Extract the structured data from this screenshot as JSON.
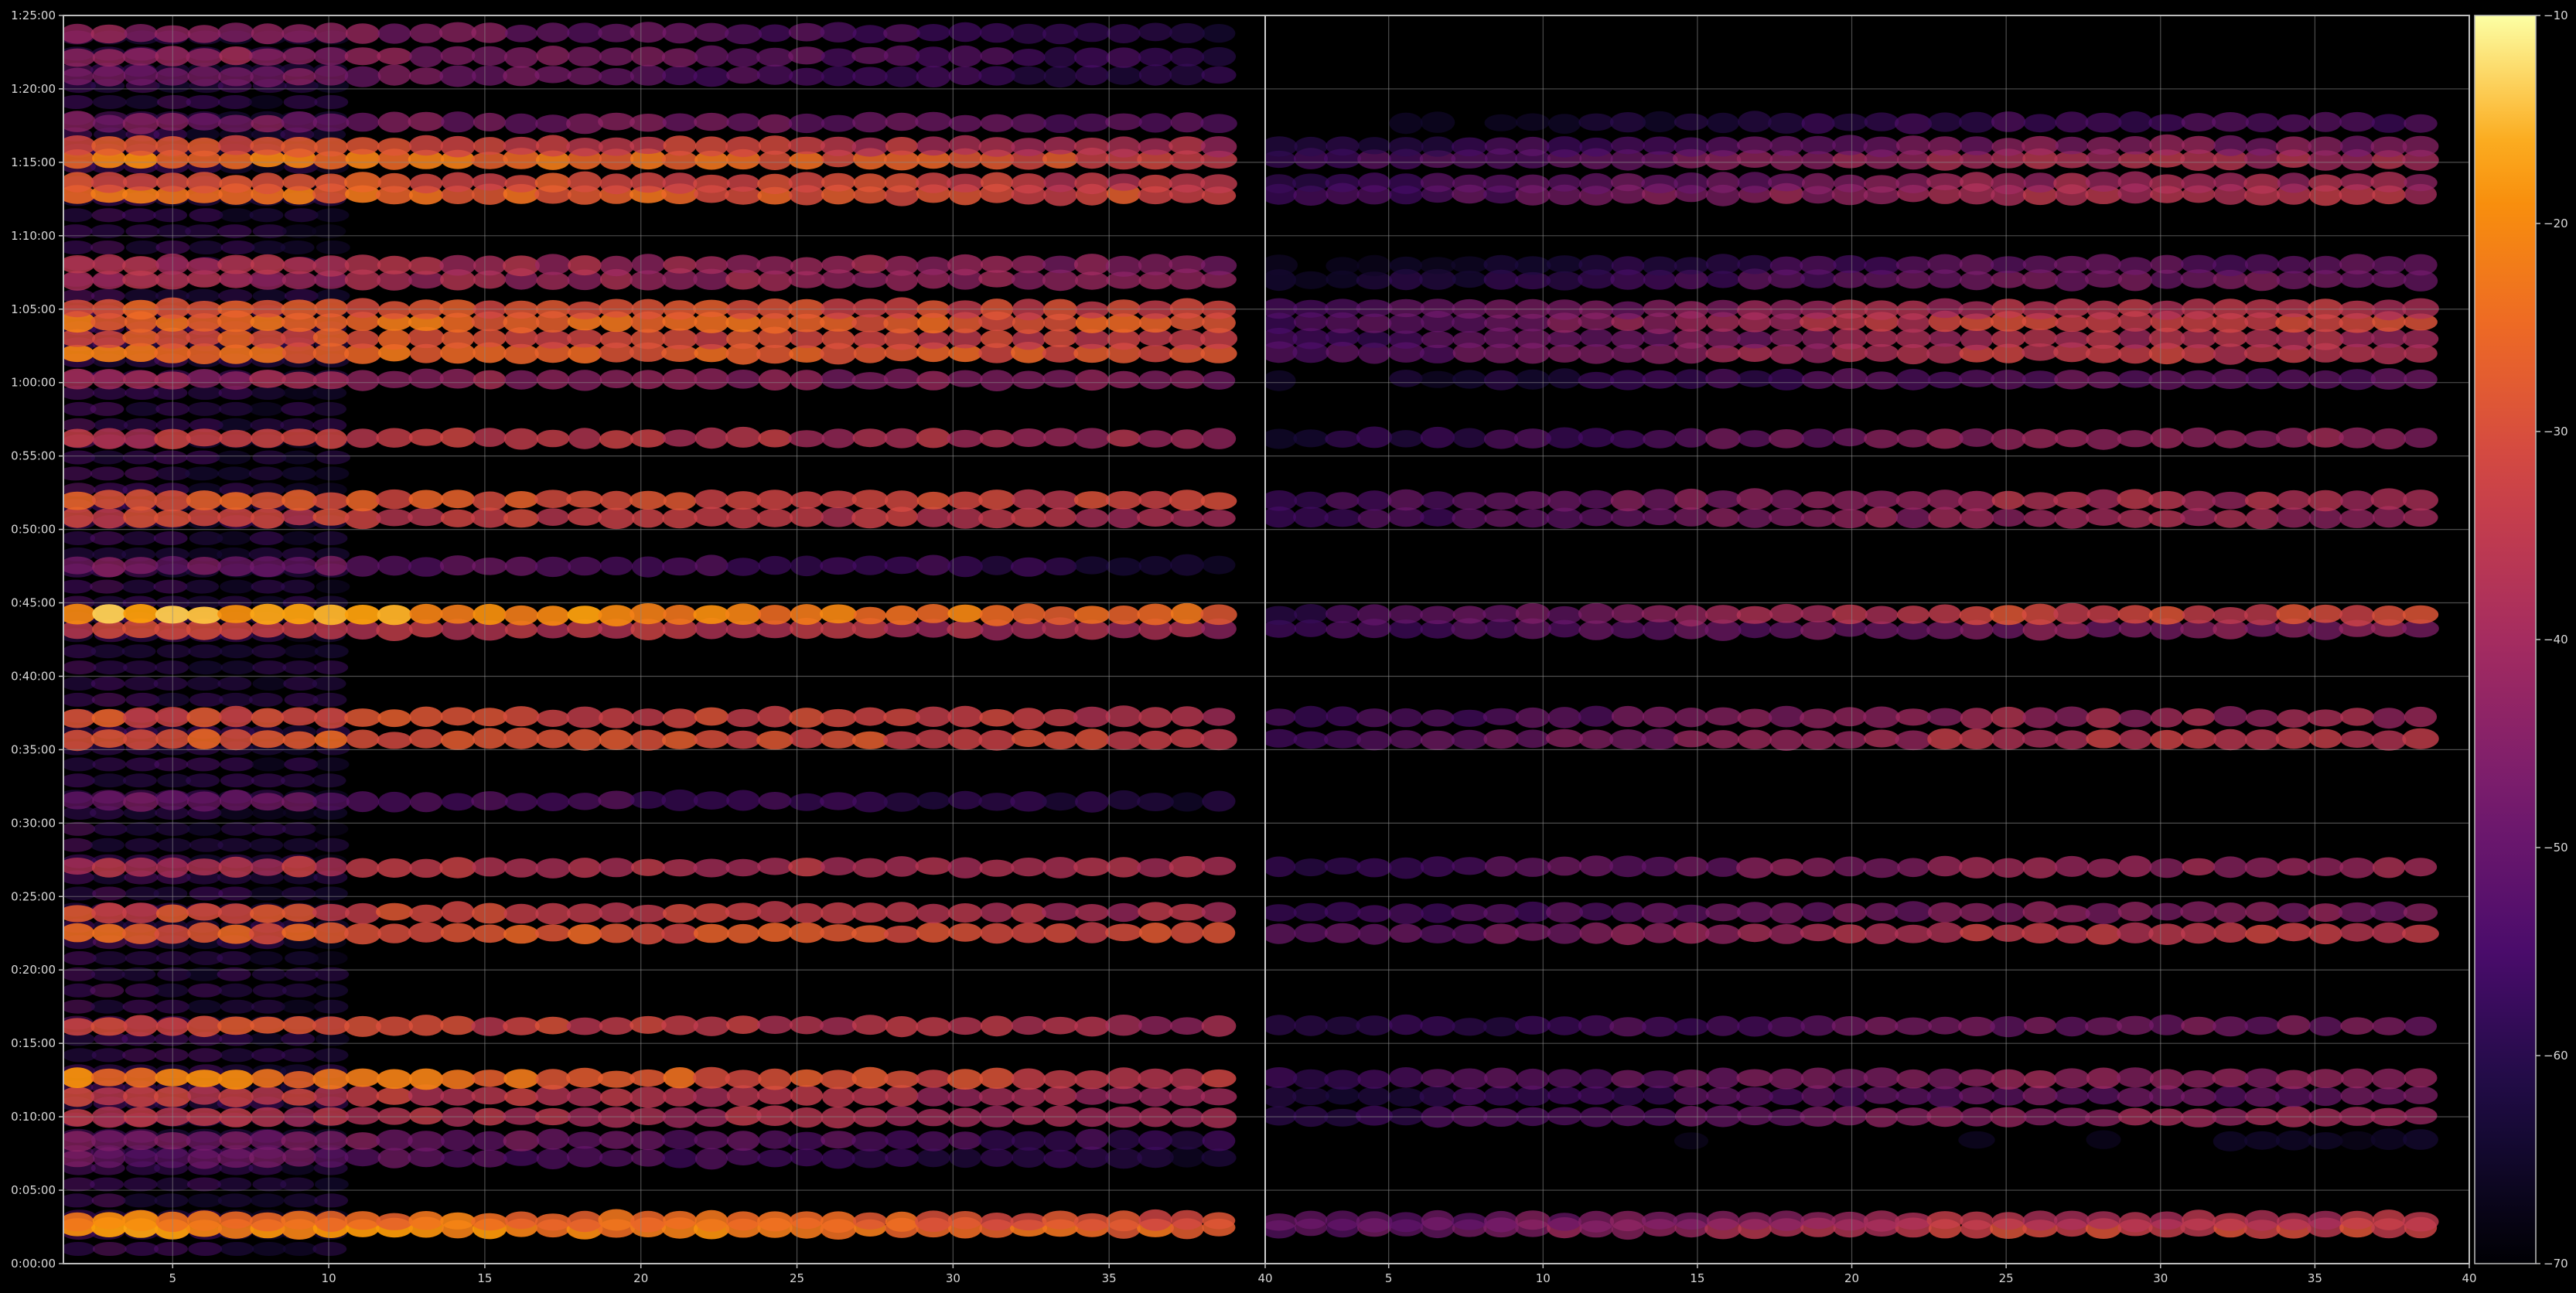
{
  "chart_data": {
    "type": "heatmap",
    "colormap": "inferno",
    "background": "#000000",
    "panels": [
      {
        "name": "left",
        "x_ticks": [
          5,
          10,
          15,
          20,
          25,
          30,
          35,
          40
        ],
        "x_range": [
          1.5,
          40
        ],
        "intensity_falloff": "gradual"
      },
      {
        "name": "right",
        "x_ticks": [
          5,
          10,
          15,
          20,
          25,
          30,
          35,
          40
        ],
        "x_range": [
          1,
          40
        ],
        "intensity_falloff": "weak-start"
      }
    ],
    "y_axis": {
      "range_minutes": [
        0,
        85
      ],
      "tick_labels": [
        "0:00:00",
        "0:05:00",
        "0:10:00",
        "0:15:00",
        "0:20:00",
        "0:25:00",
        "0:30:00",
        "0:35:00",
        "0:40:00",
        "0:45:00",
        "0:50:00",
        "0:55:00",
        "1:00:00",
        "1:05:00",
        "1:10:00",
        "1:15:00",
        "1:20:00",
        "1:25:00"
      ],
      "tick_values_minutes": [
        0,
        5,
        10,
        15,
        20,
        25,
        30,
        35,
        40,
        45,
        50,
        55,
        60,
        65,
        70,
        75,
        80,
        85
      ]
    },
    "colorbar": {
      "range": [
        -70,
        -10
      ],
      "tick_values": [
        -70,
        -60,
        -50,
        -40,
        -30,
        -20,
        -10
      ],
      "tick_labels": [
        "−70",
        "−60",
        "−50",
        "−40",
        "−30",
        "−20",
        "−10"
      ]
    },
    "bands": [
      {
        "t": 2.4,
        "left": -19,
        "right": -32,
        "right_start": -50,
        "low_onset": 40
      },
      {
        "t": 2.9,
        "left": -22,
        "right": -36,
        "right_start": -52,
        "low_onset": 40
      },
      {
        "t": 7.2,
        "left": -48,
        "right": -70,
        "right_start": -70,
        "low_onset": 20
      },
      {
        "t": 8.4,
        "left": -44,
        "right": -66,
        "right_start": -70,
        "low_onset": 24
      },
      {
        "t": 10.0,
        "left": -36,
        "right": -42,
        "right_start": -58,
        "low_onset": 35
      },
      {
        "t": 11.4,
        "left": -32,
        "right": -48,
        "right_start": -60,
        "low_onset": 36
      },
      {
        "t": 12.6,
        "left": -22,
        "right": -42,
        "right_start": -56,
        "low_onset": 38
      },
      {
        "t": 16.2,
        "left": -30,
        "right": -46,
        "right_start": -60,
        "low_onset": 30
      },
      {
        "t": 22.5,
        "left": -27,
        "right": -34,
        "right_start": -52,
        "low_onset": 36
      },
      {
        "t": 23.9,
        "left": -30,
        "right": -44,
        "right_start": -58,
        "low_onset": 34
      },
      {
        "t": 27.0,
        "left": -35,
        "right": -40,
        "right_start": -56,
        "low_onset": 34
      },
      {
        "t": 31.5,
        "left": -48,
        "right": -70,
        "right_start": -70,
        "low_onset": 18
      },
      {
        "t": 35.7,
        "left": -27,
        "right": -36,
        "right_start": -54,
        "low_onset": 40
      },
      {
        "t": 37.2,
        "left": -29,
        "right": -40,
        "right_start": -56,
        "low_onset": 40
      },
      {
        "t": 43.2,
        "left": -33,
        "right": -44,
        "right_start": -56,
        "low_onset": 38
      },
      {
        "t": 44.2,
        "left": -17,
        "right": -32,
        "right_start": -56,
        "low_onset": 40
      },
      {
        "t": 47.5,
        "left": -46,
        "right": -70,
        "right_start": -70,
        "low_onset": 20
      },
      {
        "t": 50.8,
        "left": -32,
        "right": -40,
        "right_start": -56,
        "low_onset": 38
      },
      {
        "t": 52.0,
        "left": -27,
        "right": -38,
        "right_start": -54,
        "low_onset": 40
      },
      {
        "t": 56.2,
        "left": -34,
        "right": -42,
        "right_start": -60,
        "low_onset": 35
      },
      {
        "t": 60.2,
        "left": -40,
        "right": -48,
        "right_start": -66,
        "low_onset": 30
      },
      {
        "t": 62.0,
        "left": -24,
        "right": -34,
        "right_start": -54,
        "low_onset": 40
      },
      {
        "t": 63.0,
        "left": -28,
        "right": -38,
        "right_start": -56,
        "low_onset": 40
      },
      {
        "t": 64.1,
        "left": -24,
        "right": -32,
        "right_start": -52,
        "low_onset": 40
      },
      {
        "t": 65.0,
        "left": -28,
        "right": -36,
        "right_start": -54,
        "low_onset": 40
      },
      {
        "t": 67.0,
        "left": -38,
        "right": -46,
        "right_start": -64,
        "low_onset": 32
      },
      {
        "t": 68.0,
        "left": -36,
        "right": -50,
        "right_start": -66,
        "low_onset": 30
      },
      {
        "t": 72.8,
        "left": -24,
        "right": -36,
        "right_start": -56,
        "low_onset": 40
      },
      {
        "t": 73.6,
        "left": -28,
        "right": -40,
        "right_start": -58,
        "low_onset": 40
      },
      {
        "t": 75.2,
        "left": -22,
        "right": -38,
        "right_start": -56,
        "low_onset": 40
      },
      {
        "t": 76.1,
        "left": -30,
        "right": -44,
        "right_start": -60,
        "low_onset": 40
      },
      {
        "t": 77.7,
        "left": -44,
        "right": -54,
        "right_start": -70,
        "low_onset": 28
      },
      {
        "t": 80.9,
        "left": -44,
        "right": -70,
        "right_start": -70,
        "low_onset": 18
      },
      {
        "t": 82.2,
        "left": -40,
        "right": -70,
        "right_start": -70,
        "low_onset": 18
      },
      {
        "t": 83.8,
        "left": -42,
        "right": -70,
        "right_start": -70,
        "low_onset": 16
      }
    ],
    "title": "",
    "xlabel": "",
    "ylabel": "",
    "grid": true,
    "legend": "colorbar-right"
  }
}
